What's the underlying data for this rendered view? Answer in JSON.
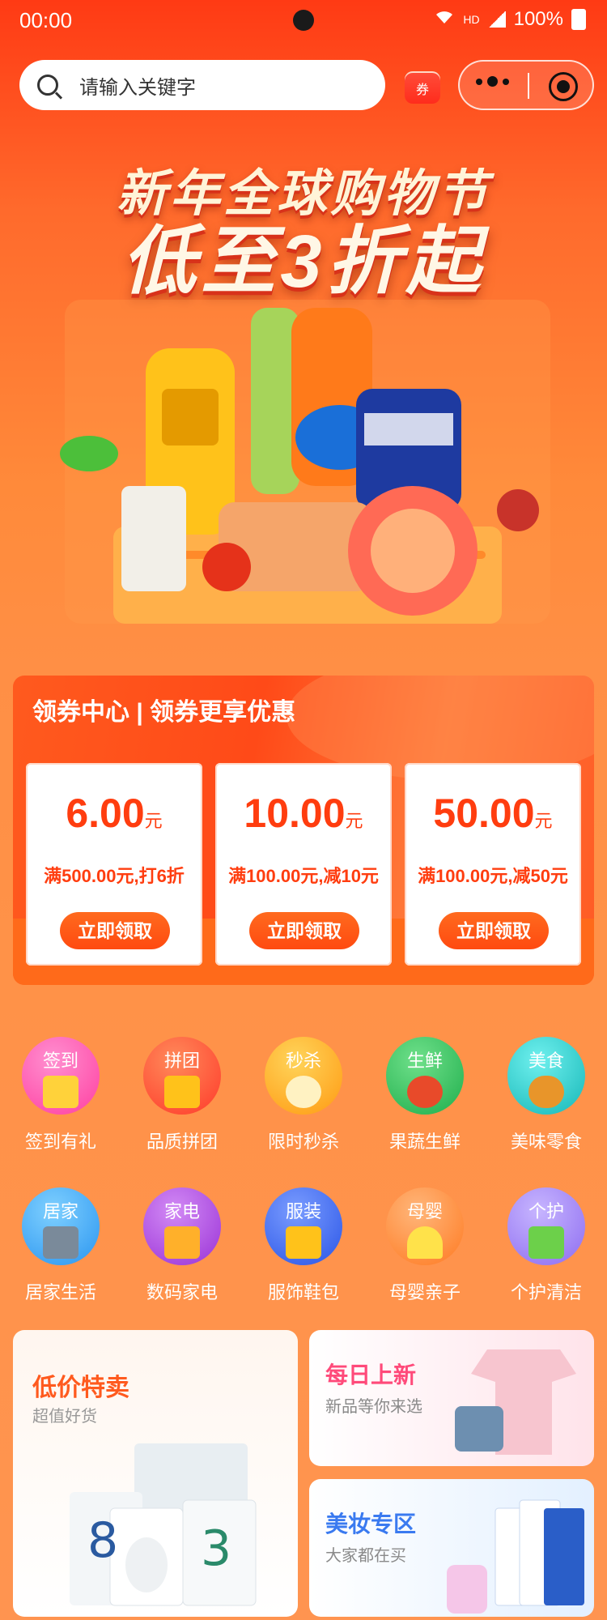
{
  "status_bar": {
    "time": "00:00",
    "hd": "HD",
    "battery": "100%"
  },
  "search": {
    "placeholder": "请输入关键字",
    "coupon_icon_text": "券"
  },
  "hero": {
    "line1": "新年全球购物节",
    "line2": "低至3折起"
  },
  "coupon_center": {
    "title": "领券中心 | 领券更享优惠",
    "unit": "元",
    "coupons": [
      {
        "amount": "6.00",
        "condition": "满500.00元,打6折",
        "button": "立即领取"
      },
      {
        "amount": "10.00",
        "condition": "满100.00元,减10元",
        "button": "立即领取"
      },
      {
        "amount": "50.00",
        "condition": "满100.00元,减50元",
        "button": "立即领取"
      }
    ]
  },
  "categories": [
    {
      "tag": "签到",
      "label": "签到有礼",
      "color": "#ff5fb1"
    },
    {
      "tag": "拼团",
      "label": "品质拼团",
      "color": "#ff4a3a"
    },
    {
      "tag": "秒杀",
      "label": "限时秒杀",
      "color": "#ffb324"
    },
    {
      "tag": "生鲜",
      "label": "果蔬生鲜",
      "color": "#34c46a"
    },
    {
      "tag": "美食",
      "label": "美味零食",
      "color": "#27c7c7"
    },
    {
      "tag": "居家",
      "label": "居家生活",
      "color": "#3aa7f5"
    },
    {
      "tag": "家电",
      "label": "数码家电",
      "color": "#b44ae0"
    },
    {
      "tag": "服装",
      "label": "服饰鞋包",
      "color": "#3d6ef5"
    },
    {
      "tag": "母婴",
      "label": "母婴亲子",
      "color": "#ff8f3a"
    },
    {
      "tag": "个护",
      "label": "个护清洁",
      "color": "#a98cf5"
    }
  ],
  "promos": {
    "low_price": {
      "title": "低价特卖",
      "subtitle": "超值好货"
    },
    "daily_new": {
      "title": "每日上新",
      "subtitle": "新品等你来选"
    },
    "beauty": {
      "title": "美妆专区",
      "subtitle": "大家都在买"
    }
  }
}
